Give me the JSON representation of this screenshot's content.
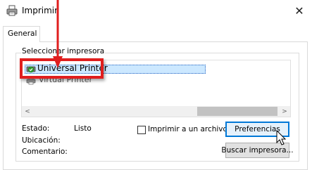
{
  "window": {
    "title": "Imprimir",
    "close_glyph": "✕"
  },
  "tabs": [
    {
      "label": "General"
    }
  ],
  "printer_group": {
    "label": "Seleccionar impresora",
    "printers": [
      {
        "name": "Universal Printer",
        "icon": "printer-default-icon",
        "selected": true
      },
      {
        "name": "Virtual Printer",
        "icon": "printer-icon",
        "selected": false
      }
    ]
  },
  "scrollbar": {
    "left_glyph": "<",
    "right_glyph": ">"
  },
  "status": {
    "estado_label": "Estado:",
    "estado_value": "Listo",
    "ubicacion_label": "Ubicación:",
    "comentario_label": "Comentario:"
  },
  "print_to_file": {
    "label": "Imprimir a un archivo",
    "checked": false
  },
  "buttons": {
    "preferences": "Preferencias",
    "find_printer": "Buscar impresora..."
  },
  "colors": {
    "annotation_red": "#e01e1e",
    "selection_bg": "#cce8ff",
    "focus_blue": "#0078d7"
  }
}
